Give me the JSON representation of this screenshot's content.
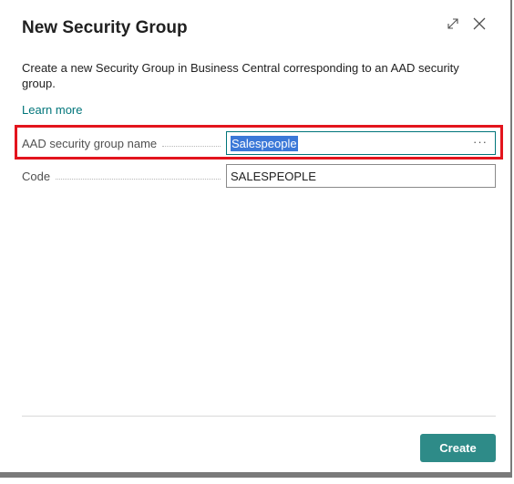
{
  "dialog": {
    "title": "New Security Group",
    "description": "Create a new Security Group in Business Central corresponding to an AAD security group.",
    "learn_more": "Learn more"
  },
  "fields": [
    {
      "label": "AAD security group name",
      "value": "Salespeople",
      "lookup": "···"
    },
    {
      "label": "Code",
      "value": "SALESPEOPLE"
    }
  ],
  "footer": {
    "create_label": "Create"
  },
  "icons": {
    "expand": "expand-icon",
    "close": "close-icon"
  },
  "colors": {
    "accent": "#00757a",
    "button": "#2e8b88",
    "highlight": "#e3141d",
    "selection": "#3b78d8"
  }
}
